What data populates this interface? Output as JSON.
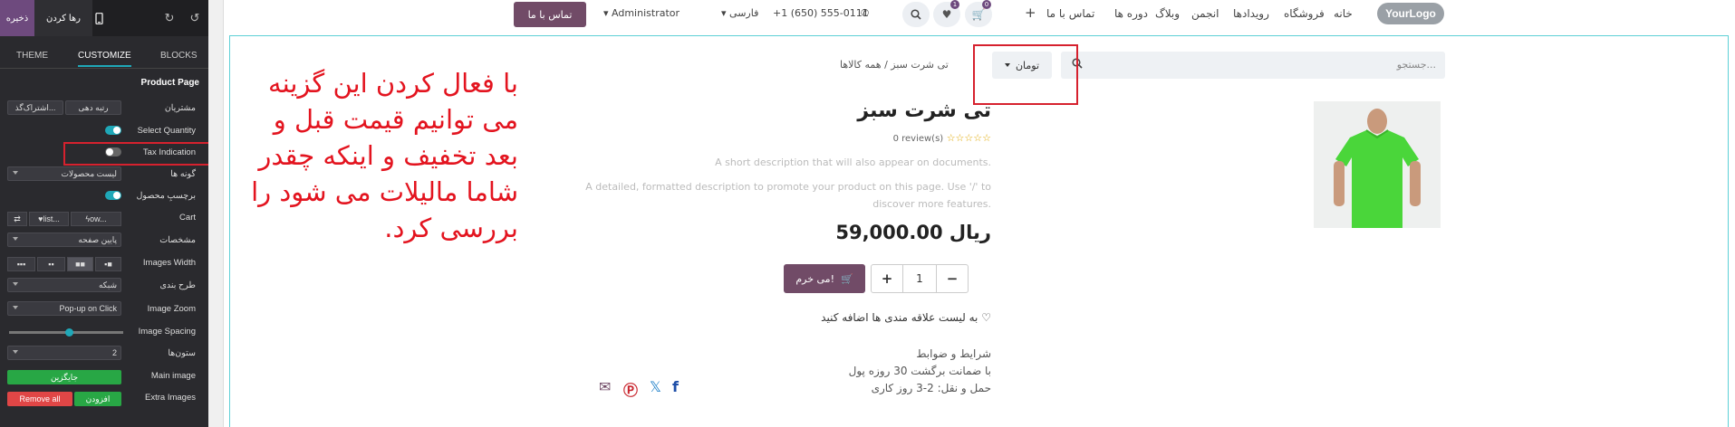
{
  "panel": {
    "save_label": "ذخیره",
    "discard_label": "رها کردن",
    "tabs": [
      "THEME",
      "CUSTOMIZE",
      "BLOCKS"
    ],
    "section_title": "Product Page",
    "rows": {
      "customers": {
        "label": "مشتریان",
        "options": [
          "رتبه دهی",
          "اشتراک‌گذ..."
        ]
      },
      "select_quantity": {
        "label": "Select Quantity"
      },
      "tax_indication": {
        "label": "Tax Indication"
      },
      "variants": {
        "label": "گونه ها",
        "value": "لیست محصولات"
      },
      "product_tag": {
        "label": "برچسبِ محصول"
      },
      "cart": {
        "label": "Cart",
        "options": [
          "ow...",
          "list...",
          "⇄"
        ]
      },
      "specs": {
        "label": "مشخصات",
        "value": "پایین صفحه"
      },
      "images_width": {
        "label": "Images Width"
      },
      "layout": {
        "label": "طرح بندی",
        "value": "شبکه"
      },
      "image_zoom": {
        "label": "Image Zoom",
        "value": "Pop-up on Click"
      },
      "image_spacing": {
        "label": "Image Spacing",
        "level": 0.52
      },
      "columns": {
        "label": "ستون‌ها",
        "value": "2"
      },
      "main_image": {
        "label": "Main image",
        "button": "جایگزین"
      },
      "extra_images": {
        "label": "Extra Images",
        "add": "افزودن",
        "remove": "Remove all"
      }
    },
    "colors": {
      "accent": "#1fa8b8",
      "save": "#6e4a7e",
      "green": "#28a745",
      "red": "#e04646"
    }
  },
  "site": {
    "logo": "YourLogo",
    "nav": [
      "خانه",
      "فروشگاه",
      "رویدادها",
      "انجمن",
      "وبلاگ",
      "دوره ها",
      "تماس با ما"
    ],
    "cart_count": "0",
    "wishlist_count": "1",
    "phone": "+1 (650) 555-0111",
    "language": "فارسی",
    "user": "Administrator",
    "contact_button": "تماس با ما",
    "brand_color": "#714b67"
  },
  "product": {
    "search_placeholder": "جستجو...",
    "pricelist": "تومان",
    "breadcrumb": [
      "همه کالاها",
      "تی شرت سبز"
    ],
    "title": "تی شرت سبز",
    "rating": "0 review(s)",
    "short_description": "A short description that will also appear on documents.",
    "long_description_1": "A detailed, formatted description to promote your product on this page. Use '/' to",
    "long_description_2": "discover more features.",
    "price": "59,000.00 ریال",
    "quantity": "1",
    "buy_button": "می خرم!",
    "wishlist_link": "به لیست علاقه مندی ها اضافه کنید",
    "terms": [
      "شرایط و ضوابط",
      "با ضمانت برگشت 30 روزه پول",
      "حمل و نقل: 2-3 روز کاری"
    ],
    "tshirt_color": "#4ad63a"
  },
  "annotation": {
    "text": "با فعال کردن این گزینه می توانیم قیمت قبل و بعد تخفیف و اینکه چقدر شاما مالیلات می شود را بررسی کرد.",
    "color": "#e3141f"
  }
}
